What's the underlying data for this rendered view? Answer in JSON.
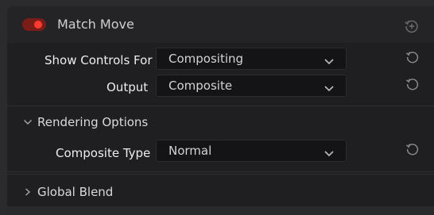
{
  "header": {
    "title": "Match Move",
    "enabled": true,
    "reset_icon": "reset-plus-icon"
  },
  "controls": [
    {
      "label": "Show Controls For",
      "value": "Compositing",
      "reset_icon": "reset-icon"
    },
    {
      "label": "Output",
      "value": "Composite",
      "reset_icon": "reset-icon"
    }
  ],
  "rendering_options": {
    "label": "Rendering Options",
    "expanded": true,
    "caret_icon": "chevron-down-icon",
    "controls": [
      {
        "label": "Composite Type",
        "value": "Normal",
        "reset_icon": "reset-icon"
      }
    ]
  },
  "global_blend": {
    "label": "Global Blend",
    "expanded": false,
    "caret_icon": "chevron-right-icon"
  },
  "colors": {
    "toggle_on": "#ff3b2f",
    "panel_bg": "#1f1f21",
    "field_bg": "#141416"
  }
}
